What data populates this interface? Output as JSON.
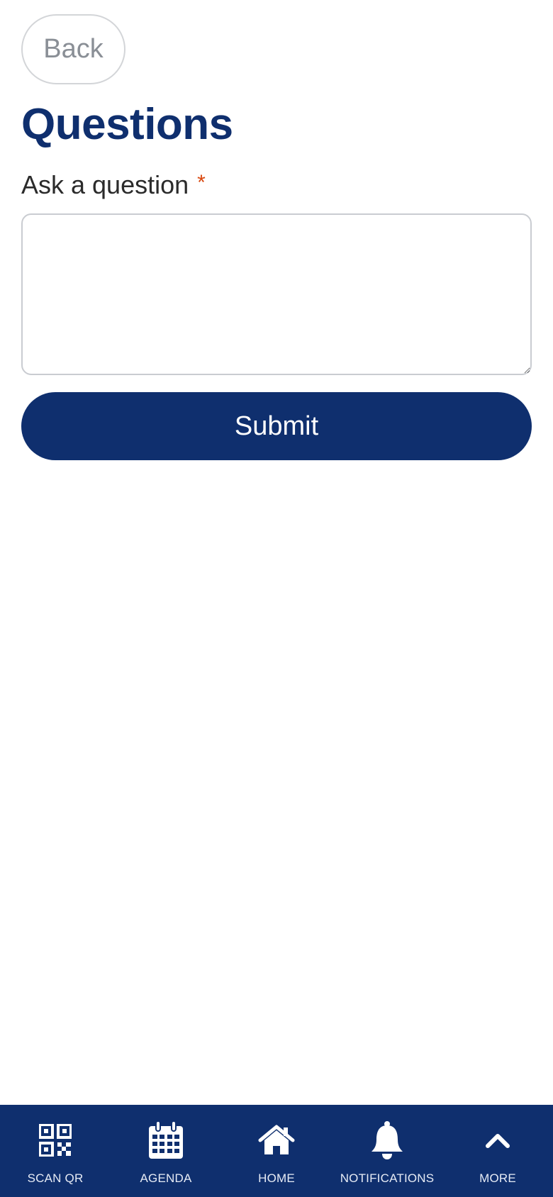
{
  "header": {
    "back_label": "Back",
    "title": "Questions"
  },
  "form": {
    "question_label": "Ask a question",
    "required_marker": "*",
    "question_value": "",
    "question_placeholder": "",
    "submit_label": "Submit"
  },
  "bottom_nav": {
    "items": [
      {
        "label": "SCAN QR",
        "icon": "qr-code-icon"
      },
      {
        "label": "AGENDA",
        "icon": "calendar-icon"
      },
      {
        "label": "HOME",
        "icon": "home-icon"
      },
      {
        "label": "NOTIFICATIONS",
        "icon": "bell-icon"
      },
      {
        "label": "MORE",
        "icon": "chevron-up-icon"
      }
    ]
  },
  "colors": {
    "brand": "#0f2f6e",
    "required": "#d9480f",
    "back_text": "#8a8f96"
  }
}
